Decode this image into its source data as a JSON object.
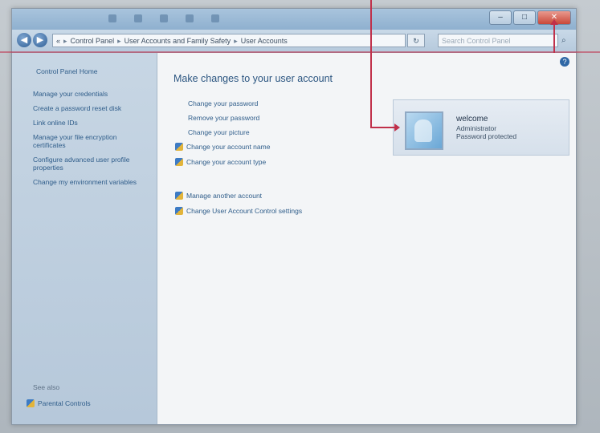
{
  "window": {
    "close_label": "✕",
    "maximize_label": "□",
    "minimize_label": "–"
  },
  "address_bar": {
    "segments": [
      "Control Panel",
      "User Accounts and Family Safety",
      "User Accounts"
    ],
    "root_label": "«",
    "search_placeholder": "Search Control Panel"
  },
  "sidebar": {
    "home": "Control Panel Home",
    "links": [
      "Manage your credentials",
      "Create a password reset disk",
      "Link online IDs",
      "Manage your file encryption certificates",
      "Configure advanced user profile properties",
      "Change my environment variables"
    ],
    "see_also": "See also",
    "parental": "Parental Controls"
  },
  "main": {
    "heading": "Make changes to your user account",
    "tasks": [
      "Change your password",
      "Remove your password",
      "Change your picture"
    ],
    "shield_tasks": [
      "Change your account name",
      "Change your account type"
    ],
    "other_tasks": [
      "Manage another account",
      "Change User Account Control settings"
    ]
  },
  "account": {
    "name": "welcome",
    "role": "Administrator",
    "status": "Password protected"
  },
  "colors": {
    "accent": "#2f5d8a",
    "callout": "#c0304a",
    "sidebar": "#c7d6e4"
  }
}
